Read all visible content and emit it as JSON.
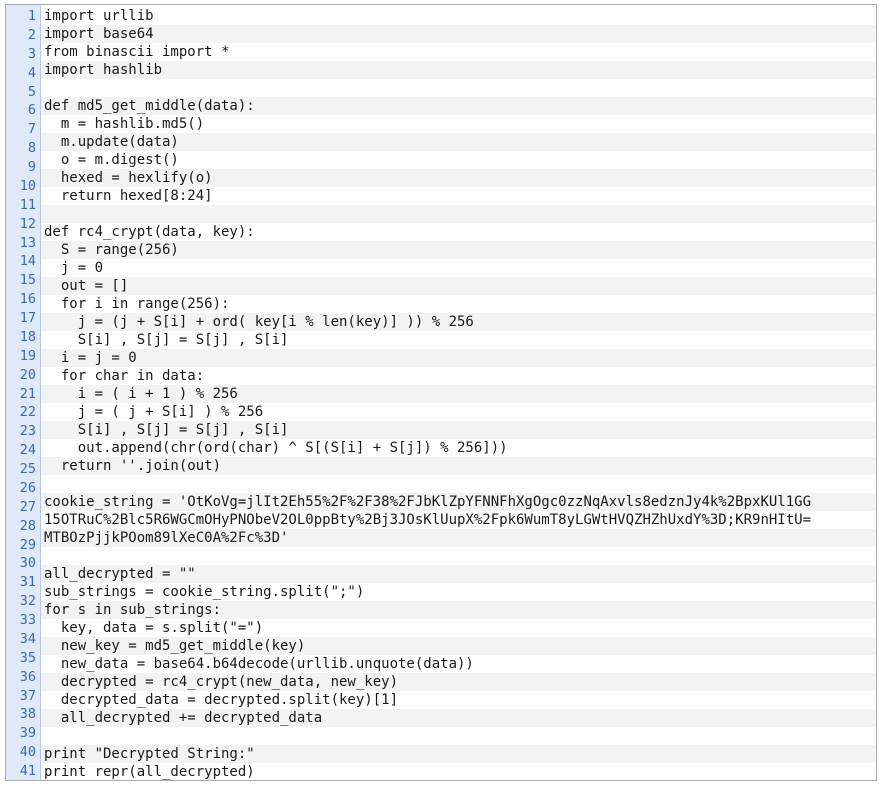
{
  "editor": {
    "lines": [
      {
        "n": "1",
        "text": "import urllib"
      },
      {
        "n": "2",
        "text": "import base64"
      },
      {
        "n": "3",
        "text": "from binascii import *"
      },
      {
        "n": "4",
        "text": "import hashlib"
      },
      {
        "n": "5",
        "text": ""
      },
      {
        "n": "6",
        "text": "def md5_get_middle(data):"
      },
      {
        "n": "7",
        "text": "  m = hashlib.md5()"
      },
      {
        "n": "8",
        "text": "  m.update(data)"
      },
      {
        "n": "9",
        "text": "  o = m.digest()"
      },
      {
        "n": "10",
        "text": "  hexed = hexlify(o)"
      },
      {
        "n": "11",
        "text": "  return hexed[8:24]"
      },
      {
        "n": "12",
        "text": ""
      },
      {
        "n": "13",
        "text": "def rc4_crypt(data, key):"
      },
      {
        "n": "14",
        "text": "  S = range(256)"
      },
      {
        "n": "15",
        "text": "  j = 0"
      },
      {
        "n": "16",
        "text": "  out = []"
      },
      {
        "n": "17",
        "text": "  for i in range(256):"
      },
      {
        "n": "18",
        "text": "    j = (j + S[i] + ord( key[i % len(key)] )) % 256"
      },
      {
        "n": "19",
        "text": "    S[i] , S[j] = S[j] , S[i]"
      },
      {
        "n": "20",
        "text": "  i = j = 0"
      },
      {
        "n": "21",
        "text": "  for char in data:"
      },
      {
        "n": "22",
        "text": "    i = ( i + 1 ) % 256"
      },
      {
        "n": "23",
        "text": "    j = ( j + S[i] ) % 256"
      },
      {
        "n": "24",
        "text": "    S[i] , S[j] = S[j] , S[i]"
      },
      {
        "n": "25",
        "text": "    out.append(chr(ord(char) ^ S[(S[i] + S[j]) % 256]))"
      },
      {
        "n": "26",
        "text": "  return ''.join(out)"
      },
      {
        "n": "27",
        "text": ""
      },
      {
        "n": "28",
        "text": "cookie_string = 'OtKoVg=jlIt2Eh55%2F%2F38%2FJbKlZpYFNNFhXgOgc0zzNqAxvls8edznJy4k%2BpxKUl1GG"
      },
      {
        "n": "",
        "text": "15OTRuC%2Blc5R6WGCmOHyPNObeV2OL0ppBty%2Bj3JOsKlUupX%2Fpk6WumT8yLGWtHVQZHZhUxdY%3D;KR9nHItU="
      },
      {
        "n": "",
        "text": "MTBOzPjjkPOom89lXeC0A%2Fc%3D'"
      },
      {
        "n": "29",
        "text": ""
      },
      {
        "n": "30",
        "text": "all_decrypted = \"\""
      },
      {
        "n": "31",
        "text": "sub_strings = cookie_string.split(\";\")"
      },
      {
        "n": "32",
        "text": "for s in sub_strings:"
      },
      {
        "n": "33",
        "text": "  key, data = s.split(\"=\")"
      },
      {
        "n": "34",
        "text": "  new_key = md5_get_middle(key)"
      },
      {
        "n": "35",
        "text": "  new_data = base64.b64decode(urllib.unquote(data))"
      },
      {
        "n": "36",
        "text": "  decrypted = rc4_crypt(new_data, new_key)"
      },
      {
        "n": "37",
        "text": "  decrypted_data = decrypted.split(key)[1]"
      },
      {
        "n": "38",
        "text": "  all_decrypted += decrypted_data"
      },
      {
        "n": "39",
        "text": ""
      },
      {
        "n": "40",
        "text": "print \"Decrypted String:\""
      },
      {
        "n": "41",
        "text": "print repr(all_decrypted)"
      }
    ],
    "gutter_numbers": [
      "1",
      "2",
      "3",
      "4",
      "5",
      "6",
      "7",
      "8",
      "9",
      "10",
      "11",
      "12",
      "13",
      "14",
      "15",
      "16",
      "17",
      "18",
      "19",
      "20",
      "21",
      "22",
      "23",
      "24",
      "25",
      "26",
      "27",
      "28",
      "29",
      "30",
      "31",
      "32",
      "33",
      "34",
      "35",
      "36",
      "37",
      "38",
      "39",
      "40",
      "41"
    ]
  },
  "colors": {
    "gutter_bg": "#dfe9f7",
    "line_number": "#3a6ab0",
    "keyword": "#1f3f9f",
    "string": "#2e7d1f",
    "number": "#c0241c",
    "stripe": "#f3f3f3"
  }
}
